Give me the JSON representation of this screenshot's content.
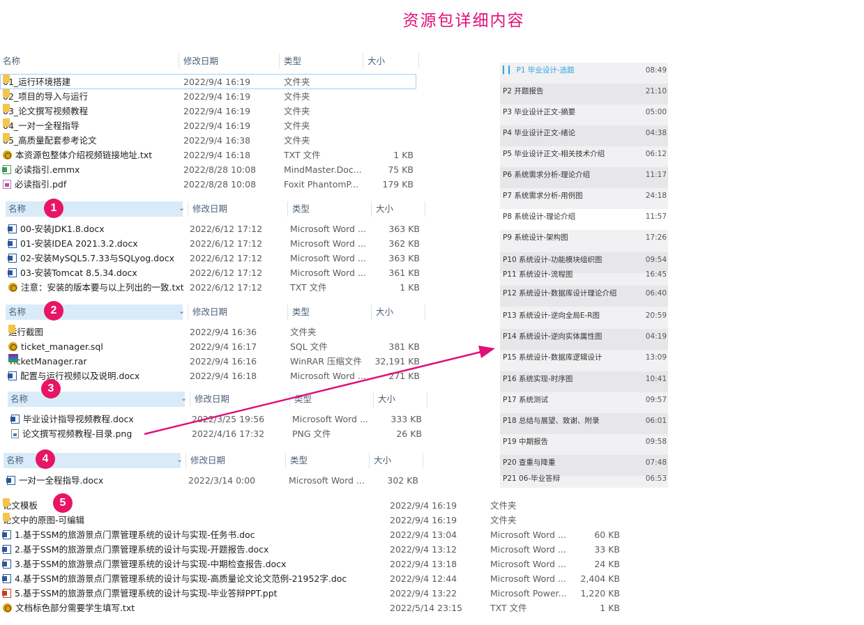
{
  "title": "资源包详细内容",
  "header": {
    "name": "名称",
    "date": "修改日期",
    "type": "类型",
    "size": "大小"
  },
  "badges": [
    "1",
    "2",
    "3",
    "4",
    "5"
  ],
  "group0": [
    {
      "icon": "folder-icon",
      "name": "01_运行环境搭建",
      "date": "2022/9/4 16:19",
      "type": "文件夹",
      "size": ""
    },
    {
      "icon": "folder-icon",
      "name": "02_项目的导入与运行",
      "date": "2022/9/4 16:19",
      "type": "文件夹",
      "size": ""
    },
    {
      "icon": "folder-icon",
      "name": "03_论文撰写视频教程",
      "date": "2022/9/4 16:19",
      "type": "文件夹",
      "size": ""
    },
    {
      "icon": "folder-icon",
      "name": "04_一对一全程指导",
      "date": "2022/9/4 16:19",
      "type": "文件夹",
      "size": ""
    },
    {
      "icon": "folder-icon",
      "name": "05_高质量配套参考论文",
      "date": "2022/9/4 16:38",
      "type": "文件夹",
      "size": ""
    },
    {
      "icon": "txt-icon",
      "name": "本资源包整体介绍视频链接地址.txt",
      "date": "2022/9/4 16:18",
      "type": "TXT 文件",
      "size": "1 KB"
    },
    {
      "icon": "emmx-icon",
      "name": "必读指引.emmx",
      "date": "2022/8/28 10:08",
      "type": "MindMaster.Doc...",
      "size": "75 KB"
    },
    {
      "icon": "pdf-icon",
      "name": "必读指引.pdf",
      "date": "2022/8/28 10:08",
      "type": "Foxit PhantomP...",
      "size": "179 KB"
    }
  ],
  "group1": [
    {
      "icon": "word-icon",
      "name": "00-安装JDK1.8.docx",
      "date": "2022/6/12 17:12",
      "type": "Microsoft Word ...",
      "size": "363 KB"
    },
    {
      "icon": "word-icon",
      "name": "01-安装IDEA 2021.3.2.docx",
      "date": "2022/6/12 17:12",
      "type": "Microsoft Word ...",
      "size": "362 KB"
    },
    {
      "icon": "word-icon",
      "name": "02-安装MySQL5.7.33与SQLyog.docx",
      "date": "2022/6/12 17:12",
      "type": "Microsoft Word ...",
      "size": "363 KB"
    },
    {
      "icon": "word-icon",
      "name": "03-安装Tomcat 8.5.34.docx",
      "date": "2022/6/12 17:12",
      "type": "Microsoft Word ...",
      "size": "361 KB"
    },
    {
      "icon": "txt-icon",
      "name": "注意：安装的版本要与以上列出的一致.txt",
      "date": "2022/6/12 17:12",
      "type": "TXT 文件",
      "size": "1 KB"
    }
  ],
  "group2": [
    {
      "icon": "folder-icon",
      "name": "运行截图",
      "date": "2022/9/4 16:36",
      "type": "文件夹",
      "size": ""
    },
    {
      "icon": "txt-icon",
      "name": "ticket_manager.sql",
      "date": "2022/9/4 16:17",
      "type": "SQL 文件",
      "size": "381 KB"
    },
    {
      "icon": "rar-icon",
      "name": "TicketManager.rar",
      "date": "2022/9/4 16:16",
      "type": "WinRAR 压缩文件",
      "size": "32,191 KB"
    },
    {
      "icon": "word-icon",
      "name": "配置与运行视频以及说明.docx",
      "date": "2022/9/4 16:18",
      "type": "Microsoft Word ...",
      "size": "271 KB"
    }
  ],
  "group3": [
    {
      "icon": "word-icon",
      "name": "毕业设计指导视频教程.docx",
      "date": "2022/3/25 19:56",
      "type": "Microsoft Word ...",
      "size": "333 KB"
    },
    {
      "icon": "png-icon",
      "name": "论文撰写视频教程-目录.png",
      "date": "2022/4/16 17:32",
      "type": "PNG 文件",
      "size": "26 KB"
    }
  ],
  "group4": [
    {
      "icon": "word-icon",
      "name": "一对一全程指导.docx",
      "date": "2022/3/14 0:00",
      "type": "Microsoft Word ...",
      "size": "302 KB"
    }
  ],
  "group5": [
    {
      "icon": "folder-icon",
      "name": "论文模板",
      "date": "2022/9/4 16:19",
      "type": "文件夹",
      "size": ""
    },
    {
      "icon": "folder-icon",
      "name": "论文中的原图-可编辑",
      "date": "2022/9/4 16:19",
      "type": "文件夹",
      "size": ""
    },
    {
      "icon": "word-icon",
      "name": "1.基于SSM的旅游景点门票管理系统的设计与实现-任务书.doc",
      "date": "2022/9/4 13:04",
      "type": "Microsoft Word ...",
      "size": "60 KB"
    },
    {
      "icon": "word-icon",
      "name": "2.基于SSM的旅游景点门票管理系统的设计与实现-开题报告.docx",
      "date": "2022/9/4 13:12",
      "type": "Microsoft Word ...",
      "size": "33 KB"
    },
    {
      "icon": "word-icon",
      "name": "3.基于SSM的旅游景点门票管理系统的设计与实现-中期检查报告.docx",
      "date": "2022/9/4 13:18",
      "type": "Microsoft Word ...",
      "size": "24 KB"
    },
    {
      "icon": "word-icon",
      "name": "4.基于SSM的旅游景点门票管理系统的设计与实现-高质量论文论文范例-21952字.doc",
      "date": "2022/9/4 12:44",
      "type": "Microsoft Word ...",
      "size": "2,404 KB"
    },
    {
      "icon": "ppt-icon",
      "name": "5.基于SSM的旅游景点门票管理系统的设计与实现-毕业答辩PPT.ppt",
      "date": "2022/9/4 13:22",
      "type": "Microsoft Power...",
      "size": "1,220 KB"
    },
    {
      "icon": "txt-icon",
      "name": "文档标色部分需要学生填写.txt",
      "date": "2022/5/14 23:15",
      "type": "TXT 文件",
      "size": "1 KB"
    }
  ],
  "playlist": [
    {
      "label": "P1  毕业设计-选题",
      "time": "08:49",
      "playing": true
    },
    {
      "label": "P2  开题报告",
      "time": "21:10"
    },
    {
      "label": "P3  毕业设计正文-摘要",
      "time": "05:00"
    },
    {
      "label": "P4  毕业设计正文-绪论",
      "time": "04:38"
    },
    {
      "label": "P5  毕业设计正文-相关技术介绍",
      "time": "06:12"
    },
    {
      "label": "P6  系统需求分析-理论介绍",
      "time": "11:17"
    },
    {
      "label": "P7  系统需求分析-用例图",
      "time": "24:18"
    },
    {
      "label": "P8  系统设计-理论介绍",
      "time": "11:57"
    },
    {
      "label": "P9  系统设计-架构图",
      "time": "17:26"
    },
    {
      "label": "P10  系统设计-功能模块组织图",
      "time": "09:54"
    },
    {
      "label": "P11  系统设计-流程图",
      "time": "16:45"
    },
    {
      "label": "P12  系统设计-数据库设计理论介绍",
      "time": "06:40"
    },
    {
      "label": "P13  系统设计-逆向全局E-R图",
      "time": "20:59"
    },
    {
      "label": "P14  系统设计-逆向实体属性图",
      "time": "04:19"
    },
    {
      "label": "P15  系统设计-数据库逻辑设计",
      "time": "13:09"
    },
    {
      "label": "P16  系统实现-时序图",
      "time": "10:41"
    },
    {
      "label": "P17  系统测试",
      "time": "09:57"
    },
    {
      "label": "P18  总结与展望、致谢、附录",
      "time": "06:01"
    },
    {
      "label": "P19  中期报告",
      "time": "09:58"
    },
    {
      "label": "P20  查重与降重",
      "time": "07:48"
    },
    {
      "label": "P21  06-毕业答辩",
      "time": "06:53"
    }
  ],
  "colors": {
    "title": "#e0107a",
    "badge": "#e71564",
    "arrow": "#e0107a",
    "header_sel": "#d9ebf9",
    "header_text": "#4c607a",
    "playlist_active": "#2fa3e0"
  }
}
